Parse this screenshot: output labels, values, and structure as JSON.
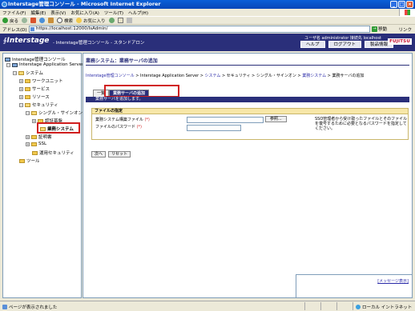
{
  "window": {
    "title": "Interstage管理コンソール - Microsoft Internet Explorer",
    "controls": [
      "_",
      "□",
      "×"
    ]
  },
  "menubar": [
    "ファイル(F)",
    "編集(E)",
    "表示(V)",
    "お気に入り(A)",
    "ツール(T)",
    "ヘルプ(H)"
  ],
  "toolbar": {
    "back_label": "戻る",
    "search_label": "検索",
    "favorites_label": "お気に入り"
  },
  "address": {
    "label": "アドレス(D)",
    "url": "https://localhost:12000/IsAdmin/",
    "go_label": "移動",
    "links_label": "リンク"
  },
  "header": {
    "logo": "Interstage",
    "subtitle": "- Interstage管理コンソール - スタンドアロン",
    "user": "ユーザ名 administrator  接続先 localhost",
    "buttons": [
      "ヘルプ",
      "ログアウト",
      "製品情報"
    ],
    "brand": "FUJITSU"
  },
  "tree": [
    "Interstage管理コンソール",
    "Interstage Application Server",
    "システム",
    "ワークユニット",
    "サービス",
    "リソース",
    "セキュリティ",
    "シングル・サインオン",
    "認証基盤",
    "業務システム",
    "証明書",
    "SSL",
    "運用セキュリティ",
    "ツール"
  ],
  "content": {
    "page_title": "業務システム：業務サーバの追加",
    "breadcrumb": {
      "c1": "Interstage管理コンソール",
      "c2": "Interstage Application Server",
      "c3": "システム",
      "c4": "セキュリティ",
      "c5": "シングル・サインオン",
      "c6": "業務システム",
      "c7": "業務サーバの追加",
      "sep": " > "
    },
    "tabs": [
      "一覧",
      "業務サーバの追加"
    ],
    "tab_strip_text": "業務サーバを追加します。",
    "form": {
      "heading": "ファイルの指定",
      "file_label": "業務システム構築ファイル",
      "password_label": "ファイルのパスワード",
      "required_mark": "(*)",
      "file_value": "",
      "password_value": "",
      "browse_label": "参照...",
      "note": "SSO管理者から受け取ったファイルとそのファイルを復号するために必要となるパスワードを指定してください。"
    },
    "buttons": [
      "次へ",
      "リセット"
    ],
    "message_link": "[メッセージ表示]"
  },
  "status": {
    "left": "ページが表示されました",
    "right": "ローカル イントラネット"
  }
}
